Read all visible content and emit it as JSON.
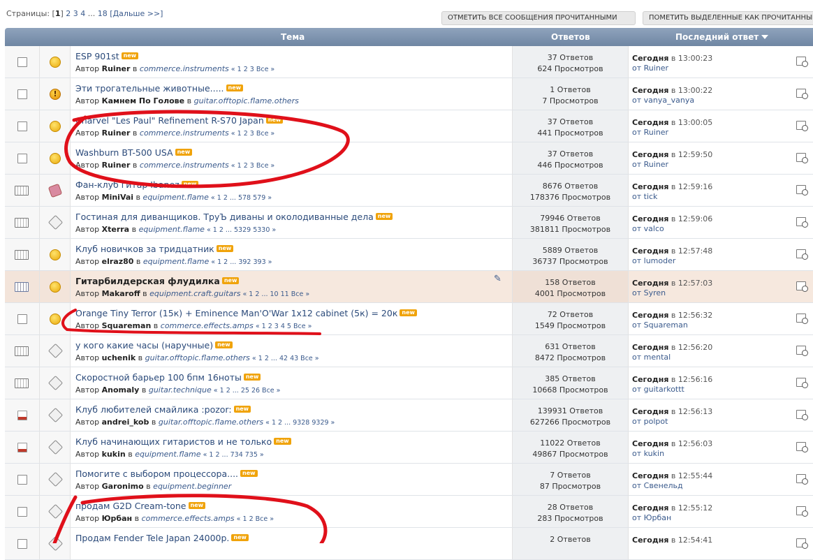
{
  "pager": {
    "label": "Страницы:",
    "lb": "[",
    "current": "1",
    "rb": "]",
    "p2": "2",
    "p3": "3",
    "p4": "4",
    "dots": "...",
    "last": "18",
    "next": "[Дальше >>]"
  },
  "buttons": {
    "mark_all_read": "ОТМЕТИТЬ ВСЕ СООБЩЕНИЯ ПРОЧИТАННЫМИ",
    "mark_selected_read": "ПОМЕТИТЬ ВЫДЕЛЕННЫЕ КАК ПРОЧИТАННЫЕ"
  },
  "header": {
    "topic": "Тема",
    "replies": "Ответов",
    "last": "Последний ответ"
  },
  "labels": {
    "by": "Автор",
    "in": "в",
    "from": "от",
    "new": "new"
  },
  "topics": [
    {
      "title": "ESP 901st",
      "author": "Ruiner",
      "cat": "commerce.instruments",
      "pages": "« 1 2 3  Все »",
      "replies": "37 Ответов",
      "views": "624 Просмотров",
      "last_day": "Сегодня",
      "last_time": "в 13:00:23",
      "last_by": "Ruiner",
      "folder": "normal",
      "status": "smile"
    },
    {
      "title": "Эти трогательные животные.....",
      "author": "Камнем По Голове",
      "cat": "guitar.offtopic.flame.others",
      "pages": "",
      "replies": "1 Ответов",
      "views": "7 Просмотров",
      "last_day": "Сегодня",
      "last_time": "в 13:00:22",
      "last_by": "vanya_vanya",
      "folder": "normal",
      "status": "excl"
    },
    {
      "title": "Charvel \"Les Paul\" Refinement R-S70 Japan",
      "author": "Ruiner",
      "cat": "commerce.instruments",
      "pages": "« 1 2 3  Все »",
      "replies": "37 Ответов",
      "views": "441 Просмотров",
      "last_day": "Сегодня",
      "last_time": "в 13:00:05",
      "last_by": "Ruiner",
      "folder": "normal",
      "status": "smile"
    },
    {
      "title": "Washburn BT-500 USA",
      "author": "Ruiner",
      "cat": "commerce.instruments",
      "pages": "« 1 2 3  Все »",
      "replies": "37 Ответов",
      "views": "446 Просмотров",
      "last_day": "Сегодня",
      "last_time": "в 12:59:50",
      "last_by": "Ruiner",
      "folder": "normal",
      "status": "smile"
    },
    {
      "title": "Фан-клуб гитар Ibanez",
      "author": "MiniVai",
      "cat": "equipment.flame",
      "pages": "« 1 2 ... 578 579 »",
      "replies": "8676 Ответов",
      "views": "178376 Просмотров",
      "last_day": "Сегодня",
      "last_time": "в 12:59:16",
      "last_by": "tick",
      "folder": "hot",
      "status": "thumb"
    },
    {
      "title": "Гостиная для диванщиков. ТруЪ диваны и околодиванные дела",
      "author": "Xterra",
      "cat": "equipment.flame",
      "pages": "« 1 2 ... 5329 5330 »",
      "replies": "79946 Ответов",
      "views": "381811 Просмотров",
      "last_day": "Сегодня",
      "last_time": "в 12:59:06",
      "last_by": "valco",
      "folder": "hot",
      "status": "diam"
    },
    {
      "title": "Клуб новичков за тридцатник",
      "author": "elraz80",
      "cat": "equipment.flame",
      "pages": "« 1 2 ... 392 393 »",
      "replies": "5889 Ответов",
      "views": "36737 Просмотров",
      "last_day": "Сегодня",
      "last_time": "в 12:57:48",
      "last_by": "lumoder",
      "folder": "hot",
      "status": "smile"
    },
    {
      "title": "Гитарбилдерская флудилка",
      "author": "Makaroff",
      "cat": "equipment.craft.guitars",
      "pages": "« 1 2 ... 10 11  Все »",
      "replies": "158 Ответов",
      "views": "4001 Просмотров",
      "last_day": "Сегодня",
      "last_time": "в 12:57:03",
      "last_by": "Syren",
      "folder": "stick",
      "status": "smile",
      "sticky": true
    },
    {
      "title": "Orange Tiny Terror (15к) + Eminence Man'O'War 1x12 cabinet (5к) = 20к",
      "author": "Squareman",
      "cat": "commerce.effects.amps",
      "pages": "« 1 2 3 4 5  Все »",
      "replies": "72 Ответов",
      "views": "1549 Просмотров",
      "last_day": "Сегодня",
      "last_time": "в 12:56:32",
      "last_by": "Squareman",
      "folder": "normal",
      "status": "smile"
    },
    {
      "title": "у кого какие часы (наручные)",
      "author": "uchenik",
      "cat": "guitar.offtopic.flame.others",
      "pages": "« 1 2 ... 42 43  Все »",
      "replies": "631 Ответов",
      "views": "8472 Просмотров",
      "last_day": "Сегодня",
      "last_time": "в 12:56:20",
      "last_by": "mental",
      "folder": "hot",
      "status": "diam"
    },
    {
      "title": "Скоростной барьер 100 бпм 16ноты",
      "author": "Anomaly",
      "cat": "guitar.technique",
      "pages": "« 1 2 ... 25 26  Все »",
      "replies": "385 Ответов",
      "views": "10668 Просмотров",
      "last_day": "Сегодня",
      "last_time": "в 12:56:16",
      "last_by": "guitarkottt",
      "folder": "hot",
      "status": "diam"
    },
    {
      "title": "Клуб любителей смайлика :pozor:",
      "author": "andrei_kob",
      "cat": "guitar.offtopic.flame.others",
      "pages": "« 1 2 ... 9328 9329 »",
      "replies": "139931 Ответов",
      "views": "627266 Просмотров",
      "last_day": "Сегодня",
      "last_time": "в 12:56:13",
      "last_by": "polpot",
      "folder": "poll",
      "status": "diam"
    },
    {
      "title": "Клуб начинающих гитаристов и не только",
      "author": "kukin",
      "cat": "equipment.flame",
      "pages": "« 1 2 ... 734 735 »",
      "replies": "11022 Ответов",
      "views": "49867 Просмотров",
      "last_day": "Сегодня",
      "last_time": "в 12:56:03",
      "last_by": "kukin",
      "folder": "poll",
      "status": "diam"
    },
    {
      "title": "Помогите с выбором процессора....",
      "author": "Garonimo",
      "cat": "equipment.beginner",
      "pages": "",
      "replies": "7 Ответов",
      "views": "87 Просмотров",
      "last_day": "Сегодня",
      "last_time": "в 12:55:44",
      "last_by": "Свенельд",
      "folder": "normal",
      "status": "diam"
    },
    {
      "title": "продам G2D Cream-tone",
      "author": "Юрбан",
      "cat": "commerce.effects.amps",
      "pages": "« 1 2  Все »",
      "replies": "28 Ответов",
      "views": "283 Просмотров",
      "last_day": "Сегодня",
      "last_time": "в 12:55:12",
      "last_by": "Юрбан",
      "folder": "normal",
      "status": "diam"
    },
    {
      "title": "Продам Fender Tele Japan 24000р.",
      "author": "",
      "cat": "",
      "pages": "",
      "replies": "2 Ответов",
      "views": "",
      "last_day": "Сегодня",
      "last_time": "в 12:54:41",
      "last_by": "",
      "folder": "normal",
      "status": "diam"
    }
  ]
}
